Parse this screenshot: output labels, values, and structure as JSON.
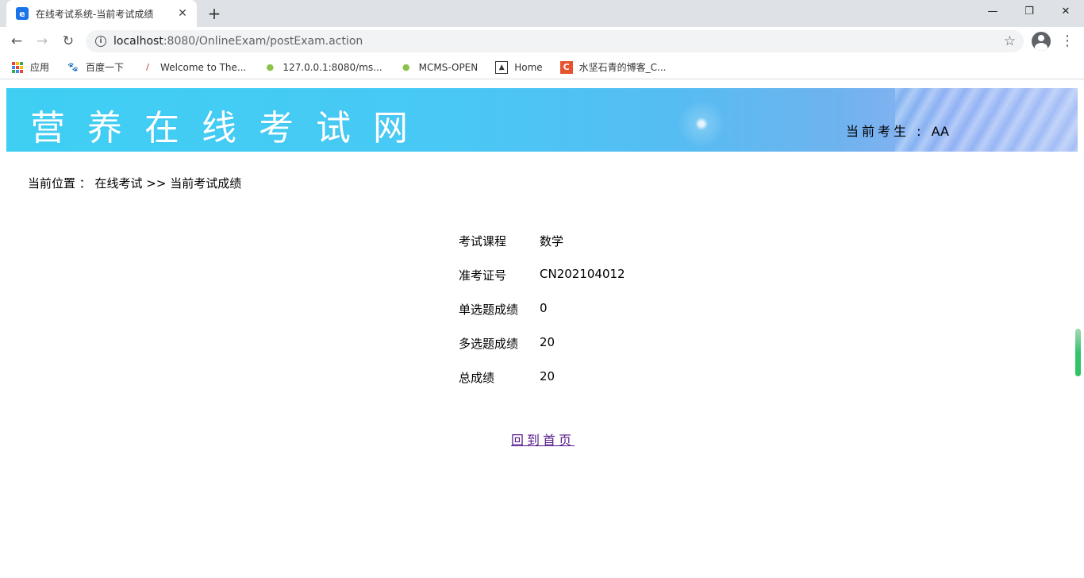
{
  "browser": {
    "tab_title": "在线考试系统-当前考试成绩",
    "url_host": "localhost",
    "url_rest": ":8080/OnlineExam/postExam.action",
    "bookmarks": [
      {
        "label": "应用",
        "icon": "apps-grid-icon"
      },
      {
        "label": "百度一下",
        "icon": "baidu-paw-icon"
      },
      {
        "label": "Welcome to The...",
        "icon": "feather-icon"
      },
      {
        "label": "127.0.0.1:8080/ms...",
        "icon": "leaf-icon"
      },
      {
        "label": "MCMS-OPEN",
        "icon": "leaf-icon"
      },
      {
        "label": "Home",
        "icon": "picture-icon"
      },
      {
        "label": "水坚石青的博客_C...",
        "icon": "csdn-c-icon"
      }
    ]
  },
  "header": {
    "site_title": "营养在线考试网",
    "current_user_label": "当前考生 : ",
    "current_user_name": "AA"
  },
  "breadcrumb": {
    "text": "当前位置 ： 在线考试 >> 当前考试成绩"
  },
  "result": {
    "rows": [
      {
        "label": "考试课程",
        "value": "数学"
      },
      {
        "label": "准考证号",
        "value": "CN202104012"
      },
      {
        "label": "单选题成绩",
        "value": "0"
      },
      {
        "label": "多选题成绩",
        "value": "20"
      },
      {
        "label": "总成绩",
        "value": "20"
      }
    ]
  },
  "links": {
    "back_home": "回到首页"
  },
  "colors": {
    "banner_start": "#3ecff3",
    "banner_end": "#a7c0f6",
    "visited_link": "#551a8b"
  }
}
